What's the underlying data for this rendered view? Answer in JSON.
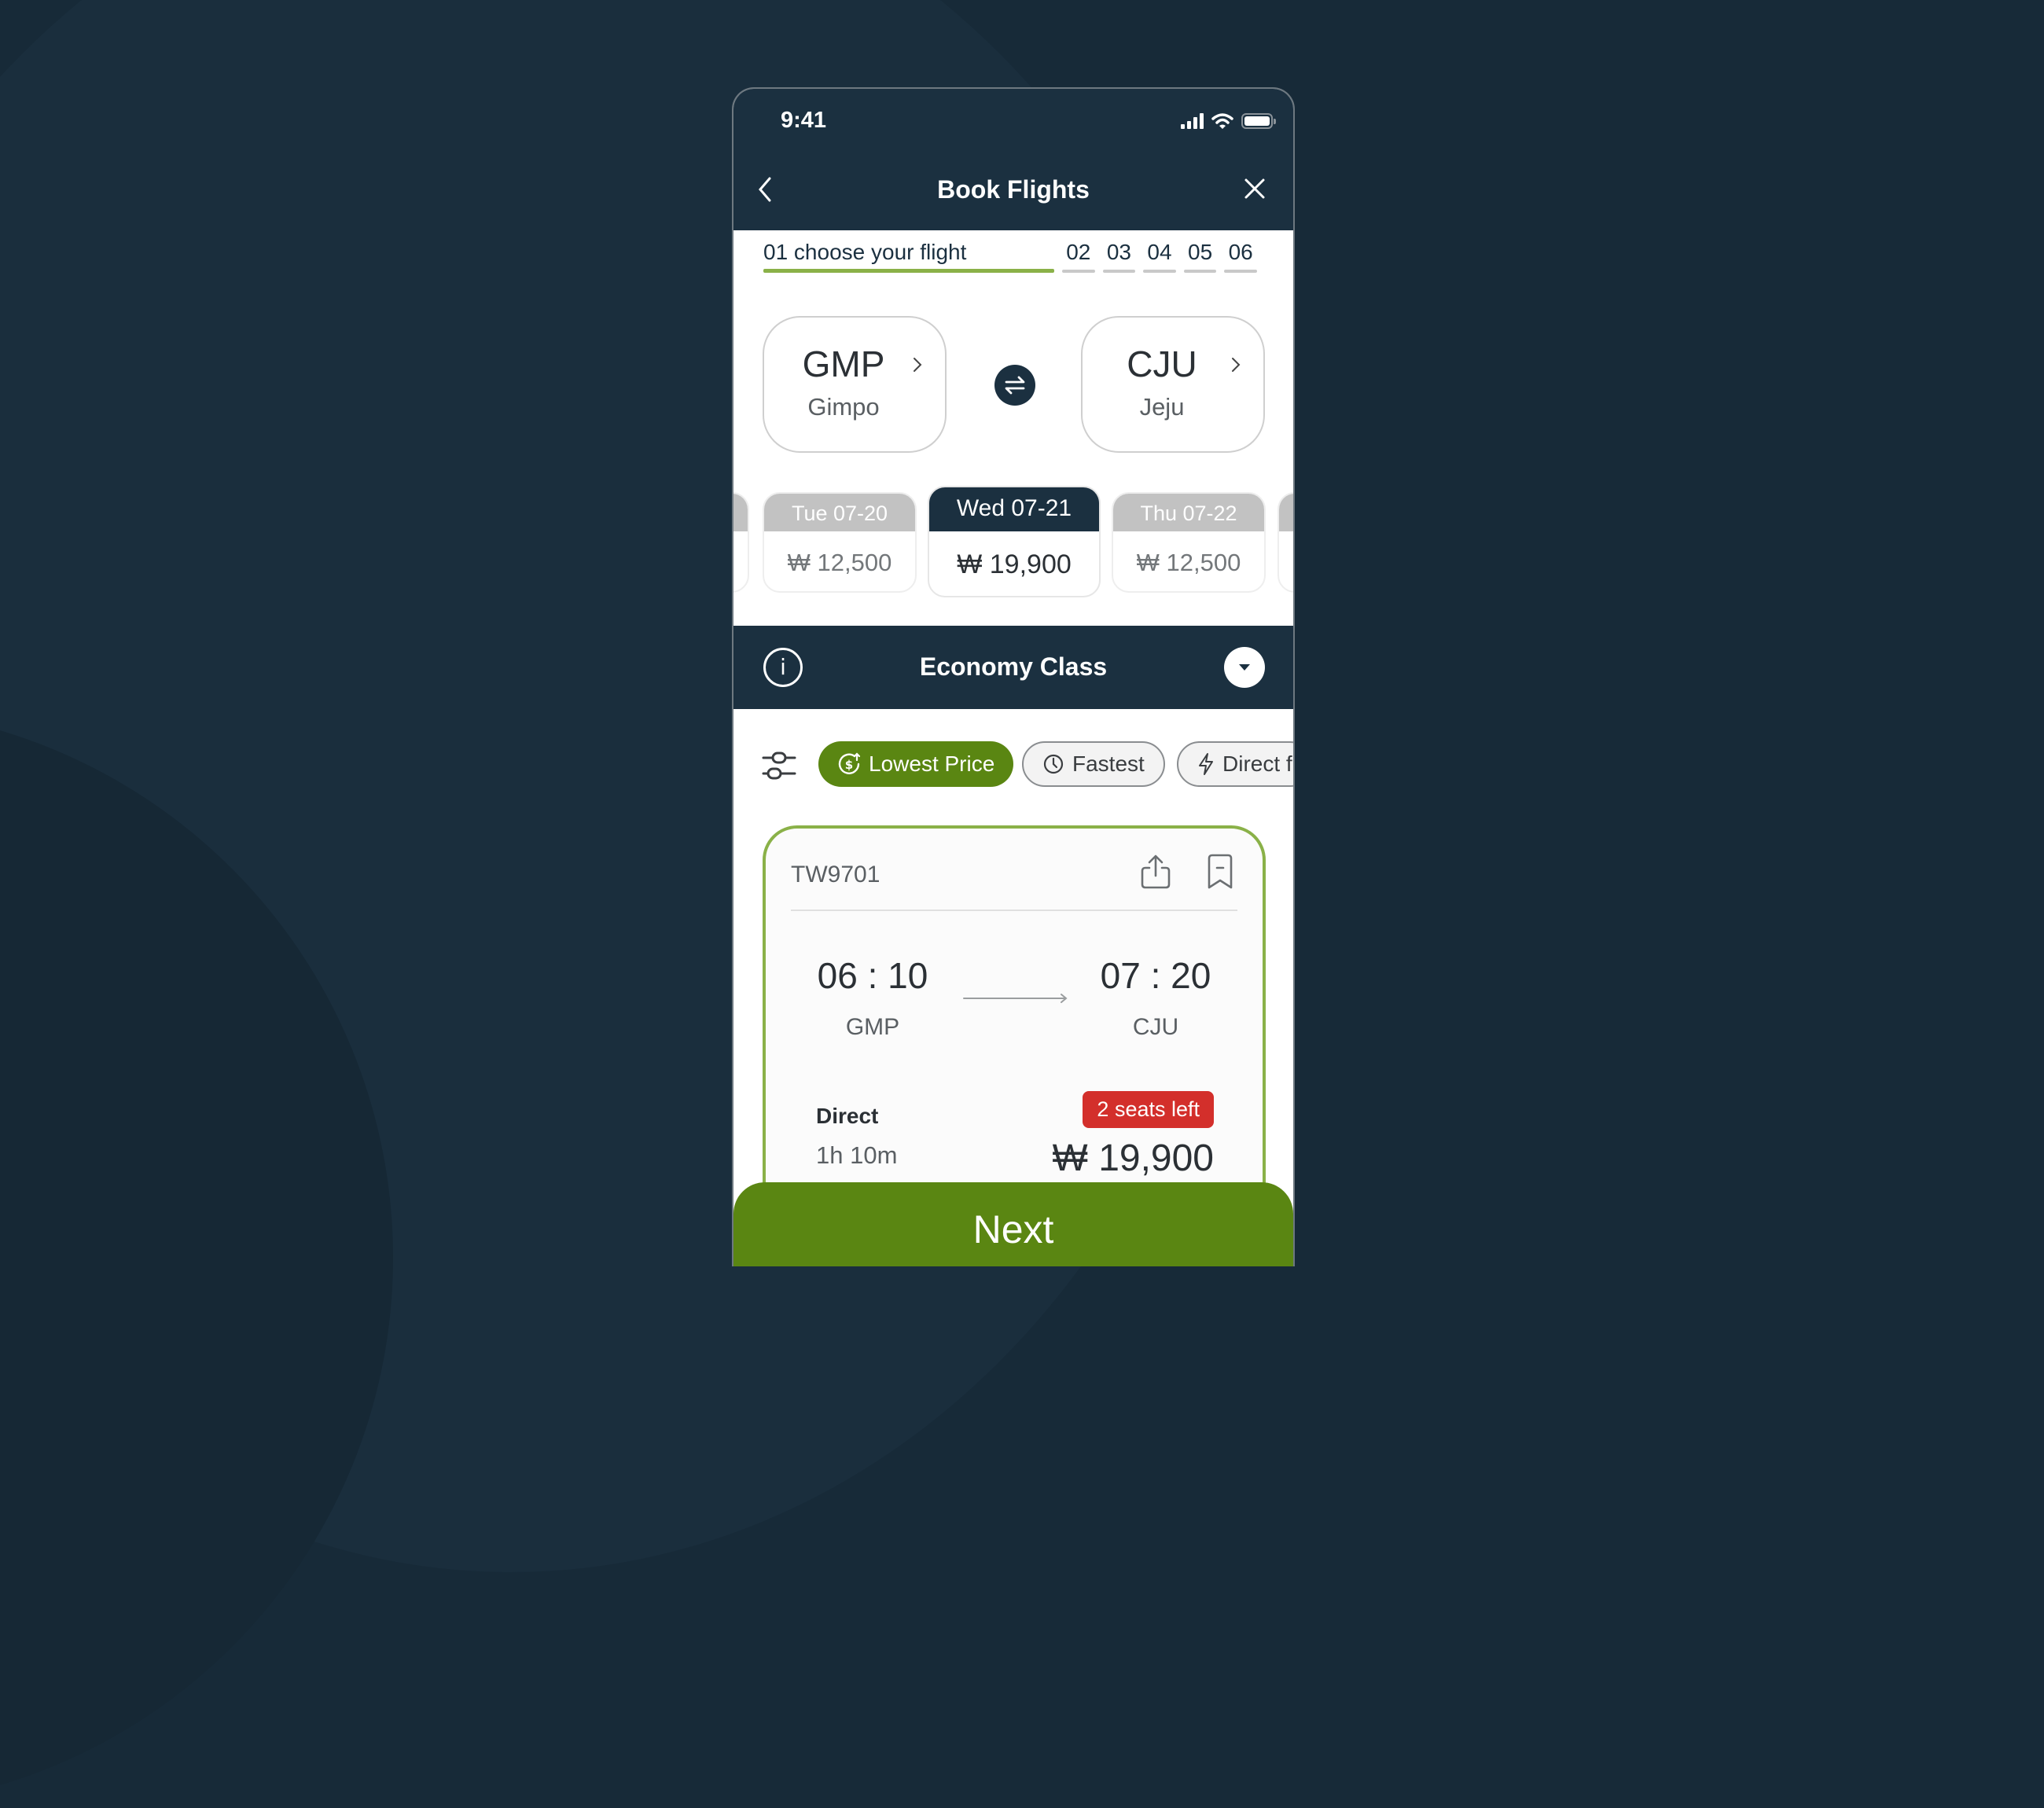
{
  "status_bar": {
    "time": "9:41"
  },
  "header": {
    "title": "Book Flights"
  },
  "steps": {
    "current": "01 choose your flight",
    "others": [
      "02",
      "03",
      "04",
      "05",
      "06"
    ]
  },
  "route": {
    "origin": {
      "code": "GMP",
      "city": "Gimpo"
    },
    "destination": {
      "code": "CJU",
      "city": "Jeju"
    }
  },
  "dates": [
    {
      "label": "Tue 07-20",
      "price": "₩ 12,500",
      "selected": false
    },
    {
      "label": "Wed 07-21",
      "price": "₩ 19,900",
      "selected": true
    },
    {
      "label": "Thu 07-22",
      "price": "₩ 12,500",
      "selected": false
    }
  ],
  "cabin_class": {
    "label": "Economy Class"
  },
  "filters": [
    {
      "label": "Lowest Price",
      "icon": "dollar-sort-icon",
      "active": true
    },
    {
      "label": "Fastest",
      "icon": "clock-icon",
      "active": false
    },
    {
      "label": "Direct f",
      "icon": "lightning-icon",
      "active": false
    }
  ],
  "flight": {
    "number": "TW9701",
    "departure_time": "06 : 10",
    "departure_code": "GMP",
    "arrival_time": "07 : 20",
    "arrival_code": "CJU",
    "stop_type": "Direct",
    "duration": "1h 10m",
    "seats_badge": "2 seats left",
    "price": "₩ 19,900"
  },
  "footer": {
    "next_label": "Next"
  },
  "colors": {
    "navy": "#1b3040",
    "brand_green": "#5a8612",
    "accent_green": "#8ab148",
    "alert_red": "#d32f2b"
  }
}
